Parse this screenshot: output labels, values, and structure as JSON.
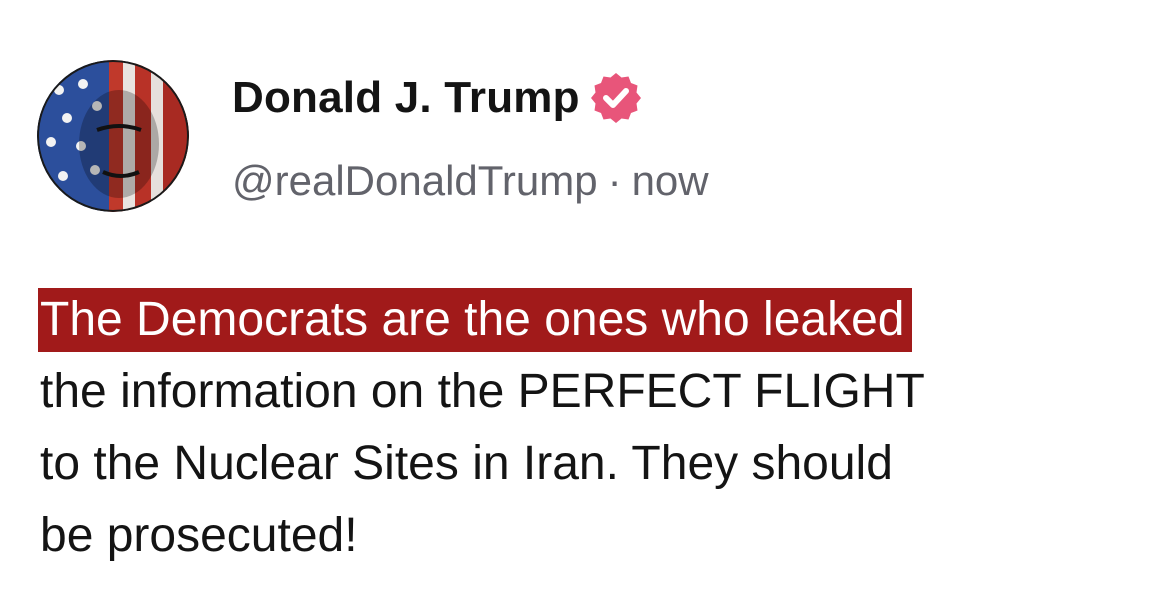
{
  "author": {
    "display_name": "Donald J. Trump",
    "handle": "@realDonaldTrump",
    "separator": "·",
    "timestamp": "now",
    "verified_icon": "verified-badge-icon",
    "verified_color": "#e8557a"
  },
  "post": {
    "highlighted_line": "The Democrats are the ones who leaked",
    "lines": [
      "the information on the PERFECT FLIGHT",
      "to the Nuclear Sites in Iran. They should",
      "be prosecuted!"
    ],
    "highlight_color": "#a11a1a"
  }
}
